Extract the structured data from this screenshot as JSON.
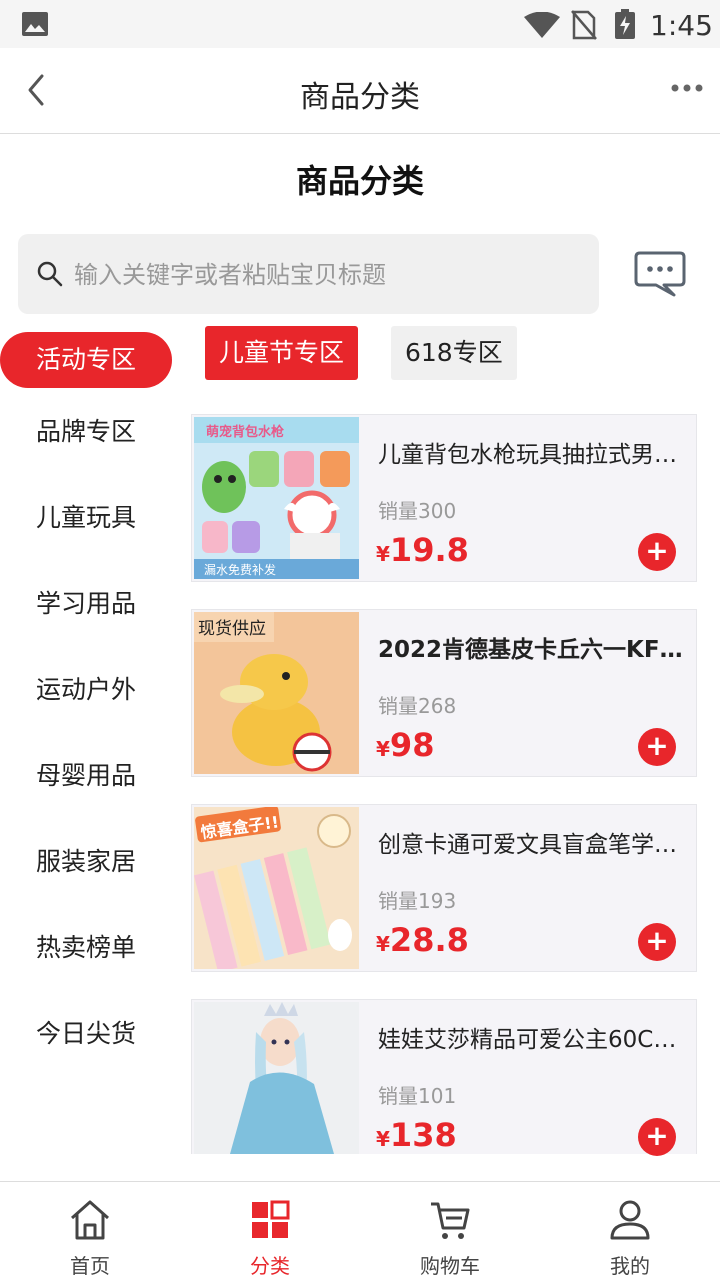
{
  "status_bar": {
    "time": "1:45"
  },
  "nav": {
    "title": "商品分类"
  },
  "page_heading": "商品分类",
  "search": {
    "placeholder": "输入关键字或者粘贴宝贝标题"
  },
  "sidebar": {
    "items": [
      {
        "label": "活动专区",
        "active": true
      },
      {
        "label": "品牌专区"
      },
      {
        "label": "儿童玩具"
      },
      {
        "label": "学习用品"
      },
      {
        "label": "运动户外"
      },
      {
        "label": "母婴用品"
      },
      {
        "label": "服装家居"
      },
      {
        "label": "热卖榜单"
      },
      {
        "label": "今日尖货"
      }
    ]
  },
  "chips": [
    {
      "label": "儿童节专区",
      "active": true
    },
    {
      "label": "618专区"
    }
  ],
  "products": [
    {
      "name": "儿童背包水枪玩具抽拉式男…",
      "sales": "销量300",
      "currency": "¥",
      "price": "19.8",
      "thumb_text": "萌宠背包水枪",
      "thumb_sub": "漏水免费补发"
    },
    {
      "name": "2022肯德基皮卡丘六一KFC…",
      "sales": "销量268",
      "currency": "¥",
      "price": "98",
      "thumb_text": "现货供应"
    },
    {
      "name": "创意卡通可爱文具盲盒笔学…",
      "sales": "销量193",
      "currency": "¥",
      "price": "28.8",
      "thumb_text": "惊喜盒子!!"
    },
    {
      "name": "娃娃艾莎精品可爱公主60C…",
      "sales": "销量101",
      "currency": "¥",
      "price": "138"
    }
  ],
  "tabbar": {
    "items": [
      {
        "label": "首页",
        "icon": "home-icon"
      },
      {
        "label": "分类",
        "icon": "category-icon",
        "active": true
      },
      {
        "label": "购物车",
        "icon": "cart-icon"
      },
      {
        "label": "我的",
        "icon": "profile-icon"
      }
    ]
  },
  "colors": {
    "accent": "#e8262b",
    "price": "#e8262b"
  }
}
